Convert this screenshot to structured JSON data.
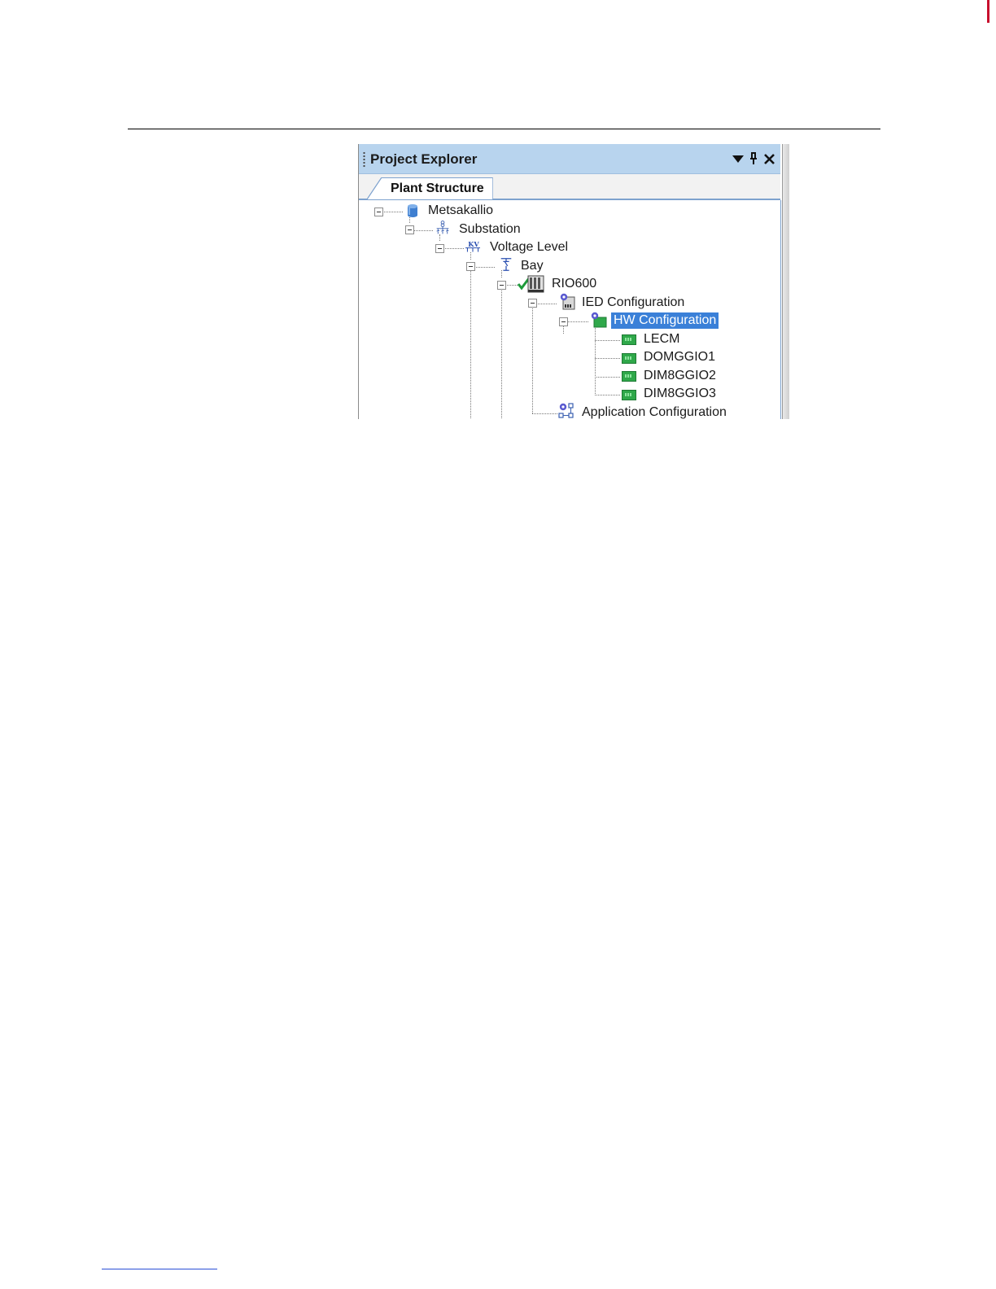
{
  "panel": {
    "title": "Project Explorer",
    "controls": [
      "dropdown-icon",
      "pin-icon",
      "close-icon"
    ],
    "tabs": [
      {
        "label": "Plant Structure",
        "active": true
      }
    ]
  },
  "tree": {
    "nodes": [
      {
        "label": "Metsakallio",
        "icon": "database-icon",
        "level": 0,
        "expanded": true
      },
      {
        "label": "Substation",
        "icon": "substation-icon",
        "level": 1,
        "expanded": true
      },
      {
        "label": "Voltage Level",
        "icon": "voltage-level-icon",
        "level": 2,
        "expanded": true
      },
      {
        "label": "Bay",
        "icon": "bay-icon",
        "level": 3,
        "expanded": true
      },
      {
        "label": "RIO600",
        "icon": "ied-device-icon",
        "level": 4,
        "expanded": true
      },
      {
        "label": "IED Configuration",
        "icon": "ied-configuration-icon",
        "level": 5,
        "expanded": true
      },
      {
        "label": "HW Configuration",
        "icon": "hw-configuration-icon",
        "level": 6,
        "expanded": true,
        "selected": true
      },
      {
        "label": "LECM",
        "icon": "module-icon",
        "level": 7
      },
      {
        "label": "DOMGGIO1",
        "icon": "module-icon",
        "level": 7
      },
      {
        "label": "DIM8GGIO2",
        "icon": "module-icon",
        "level": 7
      },
      {
        "label": "DIM8GGIO3",
        "icon": "module-icon",
        "level": 7
      },
      {
        "label": "Application Configuration",
        "icon": "application-configuration-icon",
        "level": 6
      }
    ]
  },
  "colors": {
    "title_bar": "#b8d4ee",
    "selection": "#3a80d8",
    "module_green": "#2fa84a",
    "tab_border": "#7da2ce"
  }
}
